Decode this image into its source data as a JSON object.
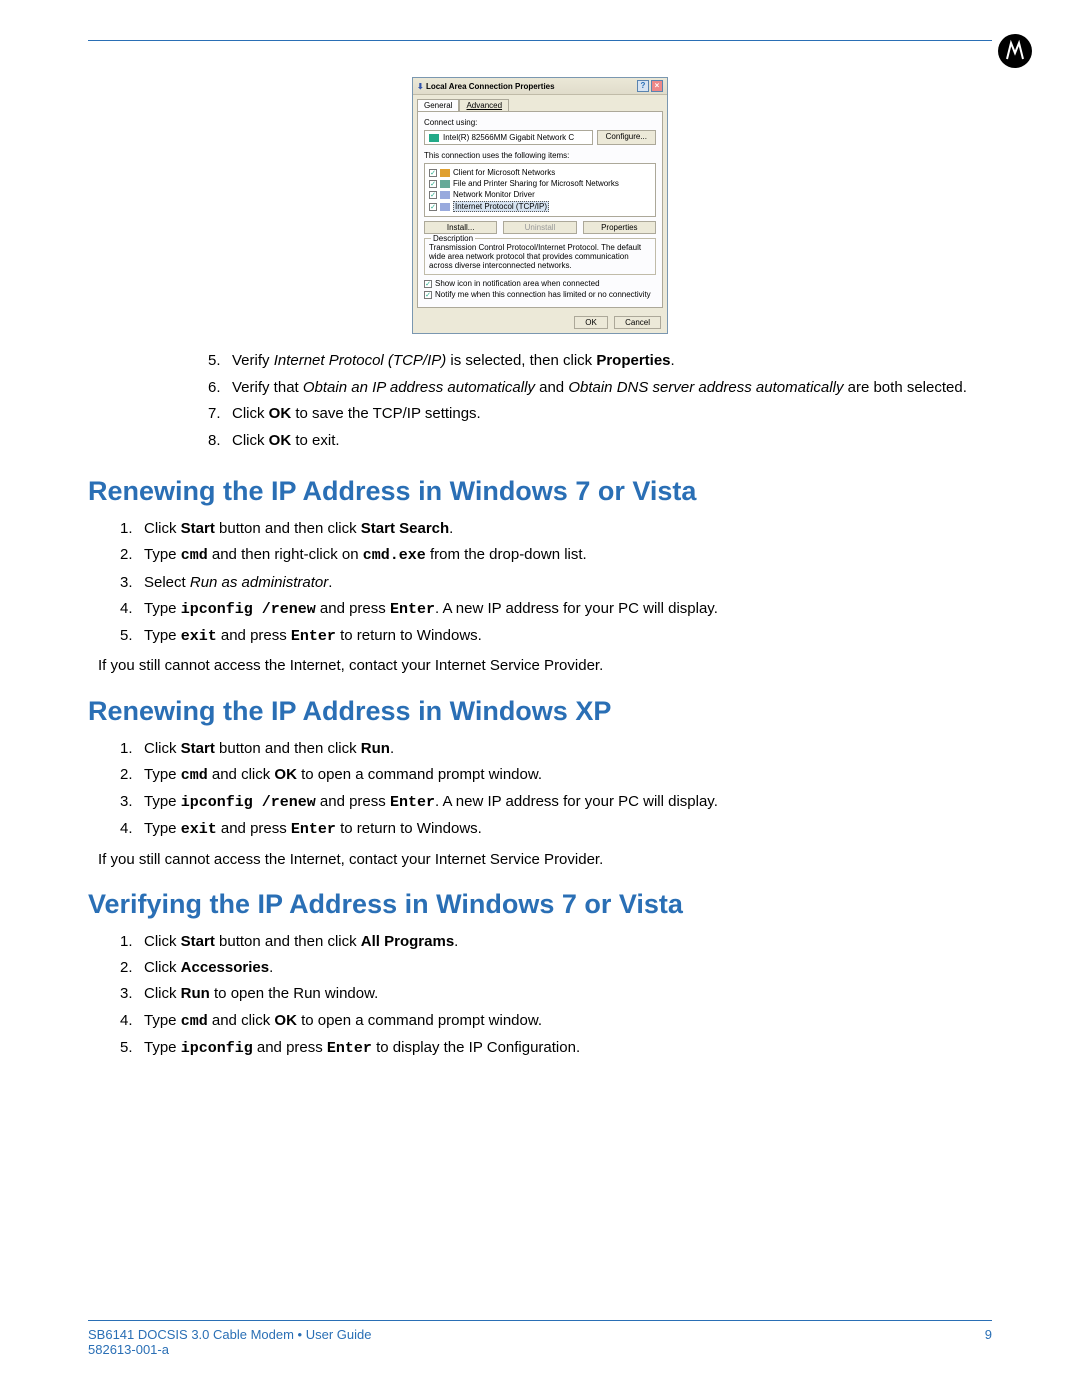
{
  "dialog": {
    "title": "Local Area Connection Properties",
    "tabs": {
      "general": "General",
      "advanced": "Advanced"
    },
    "connect_using": "Connect using:",
    "adapter": "Intel(R) 82566MM Gigabit Network C",
    "configure": "Configure...",
    "uses_items": "This connection uses the following items:",
    "items": {
      "a": "Client for Microsoft Networks",
      "b": "File and Printer Sharing for Microsoft Networks",
      "c": "Network Monitor Driver",
      "d": "Internet Protocol (TCP/IP)"
    },
    "install": "Install...",
    "uninstall": "Uninstall",
    "properties": "Properties",
    "desc_label": "Description",
    "desc_text": "Transmission Control Protocol/Internet Protocol. The default wide area network protocol that provides communication across diverse interconnected networks.",
    "show_icon": "Show icon in notification area when connected",
    "notify": "Notify me when this connection has limited or no connectivity",
    "ok": "OK",
    "cancel": "Cancel"
  },
  "steps_cont": {
    "s5": {
      "n": "5.",
      "pre": "Verify ",
      "it": "Internet Protocol (TCP/IP)",
      "mid": " is selected, then click ",
      "b": "Properties",
      "post": "."
    },
    "s6": {
      "n": "6.",
      "pre": "Verify that ",
      "it1": "Obtain an IP address automatically",
      "and": " and ",
      "it2": "Obtain DNS server address automatically",
      "post": " are both selected."
    },
    "s7": {
      "n": "7.",
      "pre": "Click ",
      "b": "OK",
      "post": " to save the TCP/IP settings."
    },
    "s8": {
      "n": "8.",
      "pre": "Click ",
      "b": "OK",
      "post": " to exit."
    }
  },
  "sec1": {
    "title": "Renewing the IP Address in Windows 7 or Vista",
    "s1": {
      "n": "1.",
      "pre": "Click ",
      "b1": "Start",
      "mid": " button and then click ",
      "b2": "Start Search",
      "post": "."
    },
    "s2": {
      "n": "2.",
      "pre": "Type ",
      "m1": "cmd",
      "mid": " and then right-click on ",
      "m2": "cmd.exe",
      "post": " from the drop-down list."
    },
    "s3": {
      "n": "3.",
      "pre": "Select ",
      "it": "Run as administrator",
      "post": "."
    },
    "s4": {
      "n": "4.",
      "pre": "Type ",
      "m1": "ipconfig /renew",
      "mid": " and press ",
      "m2": "Enter",
      "post": ". A new IP address for your PC will display."
    },
    "s5": {
      "n": "5.",
      "pre": "Type ",
      "m1": "exit",
      "mid": " and press ",
      "m2": "Enter",
      "post": " to return to Windows."
    },
    "note": "If you still cannot access the Internet, contact your Internet Service Provider."
  },
  "sec2": {
    "title": "Renewing the IP Address in Windows XP",
    "s1": {
      "n": "1.",
      "pre": "Click ",
      "b1": "Start",
      "mid": " button and then click ",
      "b2": "Run",
      "post": "."
    },
    "s2": {
      "n": "2.",
      "pre": "Type ",
      "m1": "cmd",
      "mid": " and click ",
      "b": "OK",
      "post": " to open a command prompt window."
    },
    "s3": {
      "n": "3.",
      "pre": "Type ",
      "m1": "ipconfig /renew",
      "mid": " and press ",
      "m2": "Enter",
      "post": ". A new IP address for your PC will display."
    },
    "s4": {
      "n": "4.",
      "pre": "Type ",
      "m1": "exit",
      "mid": " and press ",
      "m2": "Enter",
      "post": " to return to Windows."
    },
    "note": "If you still cannot access the Internet, contact your Internet Service Provider."
  },
  "sec3": {
    "title": "Verifying the IP Address in Windows 7 or Vista",
    "s1": {
      "n": "1.",
      "pre": "Click ",
      "b1": "Start",
      "mid": " button and then click ",
      "b2": "All Programs",
      "post": "."
    },
    "s2": {
      "n": "2.",
      "pre": "Click ",
      "b": "Accessories",
      "post": "."
    },
    "s3": {
      "n": "3.",
      "pre": "Click ",
      "b": "Run",
      "post": " to open the Run window."
    },
    "s4": {
      "n": "4.",
      "pre": "Type ",
      "m1": "cmd",
      "mid": " and click ",
      "b": "OK",
      "post": " to open a command prompt window."
    },
    "s5": {
      "n": "5.",
      "pre": "Type ",
      "m1": "ipconfig",
      "mid": " and press ",
      "m2": "Enter",
      "post": " to display the IP Configuration."
    }
  },
  "footer": {
    "left": "SB6141 DOCSIS 3.0 Cable Modem • User Guide",
    "right": "9",
    "rev": "582613-001-a"
  }
}
